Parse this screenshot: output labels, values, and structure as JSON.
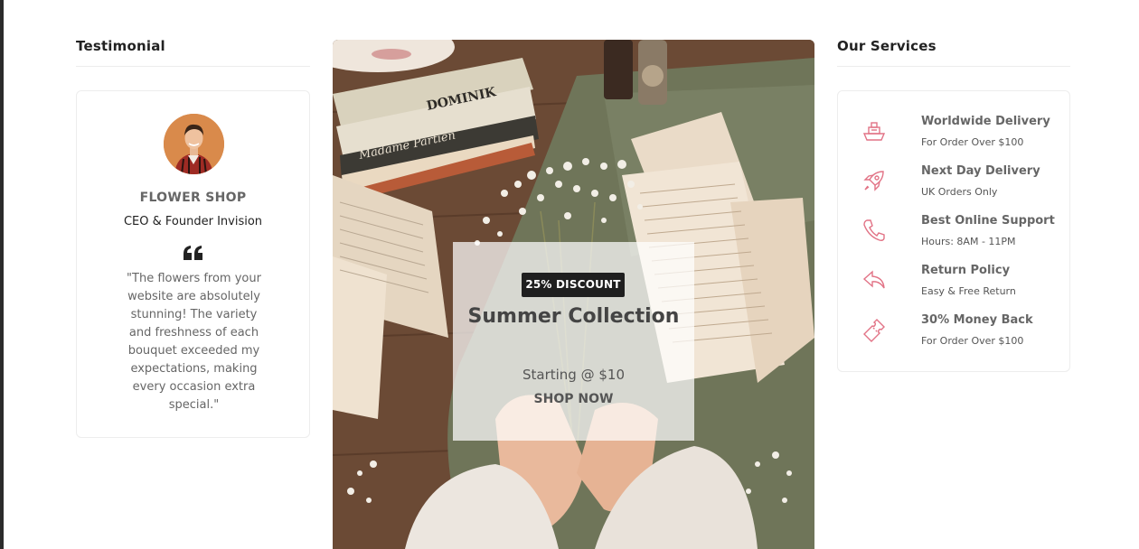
{
  "testimonial": {
    "heading": "Testimonial",
    "name": "FLOWER SHOP",
    "role": "CEO & Founder Invision",
    "quote": "\"The flowers from your website are absolutely stunning! The variety and freshness of each bouquet exceeded my expectations, making every occasion extra special.\""
  },
  "banner": {
    "badge": "25% DISCOUNT",
    "title": "Summer Collection",
    "price": "Starting @ $10",
    "cta": "SHOP NOW",
    "book_text_1": "DOMINIK",
    "book_text_2": "Madame Partiën"
  },
  "services": {
    "heading": "Our Services",
    "items": [
      {
        "title": "Worldwide Delivery",
        "subtitle": "For Order Over $100",
        "icon": "ship-icon"
      },
      {
        "title": "Next Day Delivery",
        "subtitle": "UK Orders Only",
        "icon": "rocket-icon"
      },
      {
        "title": "Best Online Support",
        "subtitle": "Hours: 8AM - 11PM",
        "icon": "phone-icon"
      },
      {
        "title": "Return Policy",
        "subtitle": "Easy & Free Return",
        "icon": "return-icon"
      },
      {
        "title": "30% Money Back",
        "subtitle": "For Order Over $100",
        "icon": "ticket-icon"
      }
    ]
  },
  "colors": {
    "accent": "#e27386",
    "badge_bg": "#1f1f1f",
    "text_muted": "#666666"
  }
}
